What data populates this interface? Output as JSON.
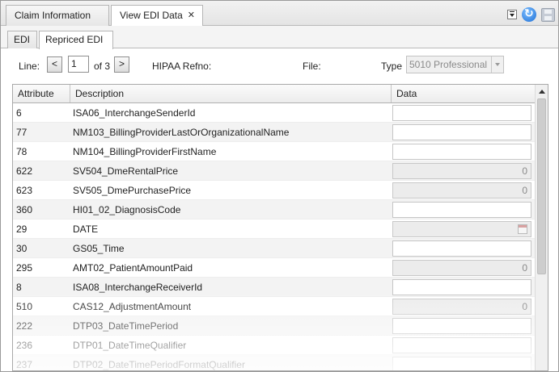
{
  "top_tabs": [
    {
      "label": "Claim Information"
    },
    {
      "label": "View EDI Data",
      "close": "✕"
    }
  ],
  "toolbar_icons": [
    "dropdown-menu-icon",
    "refresh-icon",
    "save-icon"
  ],
  "inner_tabs": [
    {
      "label": "EDI"
    },
    {
      "label": "Repriced EDI"
    }
  ],
  "nav": {
    "line_label": "Line:",
    "prev": "<",
    "line_value": "1",
    "of_label": "of 3",
    "next": ">",
    "hipaa_label": "HIPAA Refno:",
    "file_label": "File:",
    "type_label": "Type",
    "type_value": "5010 Professional"
  },
  "grid": {
    "columns": [
      "Attribute",
      "Description",
      "Data"
    ],
    "rows": [
      {
        "attr": "6",
        "desc": "ISA06_InterchangeSenderId",
        "data": "",
        "kind": "text"
      },
      {
        "attr": "77",
        "desc": "NM103_BillingProviderLastOrOrganizationalName",
        "data": "",
        "kind": "text"
      },
      {
        "attr": "78",
        "desc": "NM104_BillingProviderFirstName",
        "data": "",
        "kind": "text"
      },
      {
        "attr": "622",
        "desc": "SV504_DmeRentalPrice",
        "data": "0",
        "kind": "number"
      },
      {
        "attr": "623",
        "desc": "SV505_DmePurchasePrice",
        "data": "0",
        "kind": "number"
      },
      {
        "attr": "360",
        "desc": "HI01_02_DiagnosisCode",
        "data": "",
        "kind": "text"
      },
      {
        "attr": "29",
        "desc": "DATE",
        "data": "",
        "kind": "date"
      },
      {
        "attr": "30",
        "desc": "GS05_Time",
        "data": "",
        "kind": "text"
      },
      {
        "attr": "295",
        "desc": "AMT02_PatientAmountPaid",
        "data": "0",
        "kind": "number"
      },
      {
        "attr": "8",
        "desc": "ISA08_InterchangeReceiverId",
        "data": "",
        "kind": "text"
      },
      {
        "attr": "510",
        "desc": "CAS12_AdjustmentAmount",
        "data": "0",
        "kind": "number"
      },
      {
        "attr": "222",
        "desc": "DTP03_DateTimePeriod",
        "data": "",
        "kind": "text"
      },
      {
        "attr": "236",
        "desc": "DTP01_DateTimeQualifier",
        "data": "",
        "kind": "text"
      },
      {
        "attr": "237",
        "desc": "DTP02_DateTimePeriodFormatQualifier",
        "data": "",
        "kind": "text"
      }
    ]
  }
}
